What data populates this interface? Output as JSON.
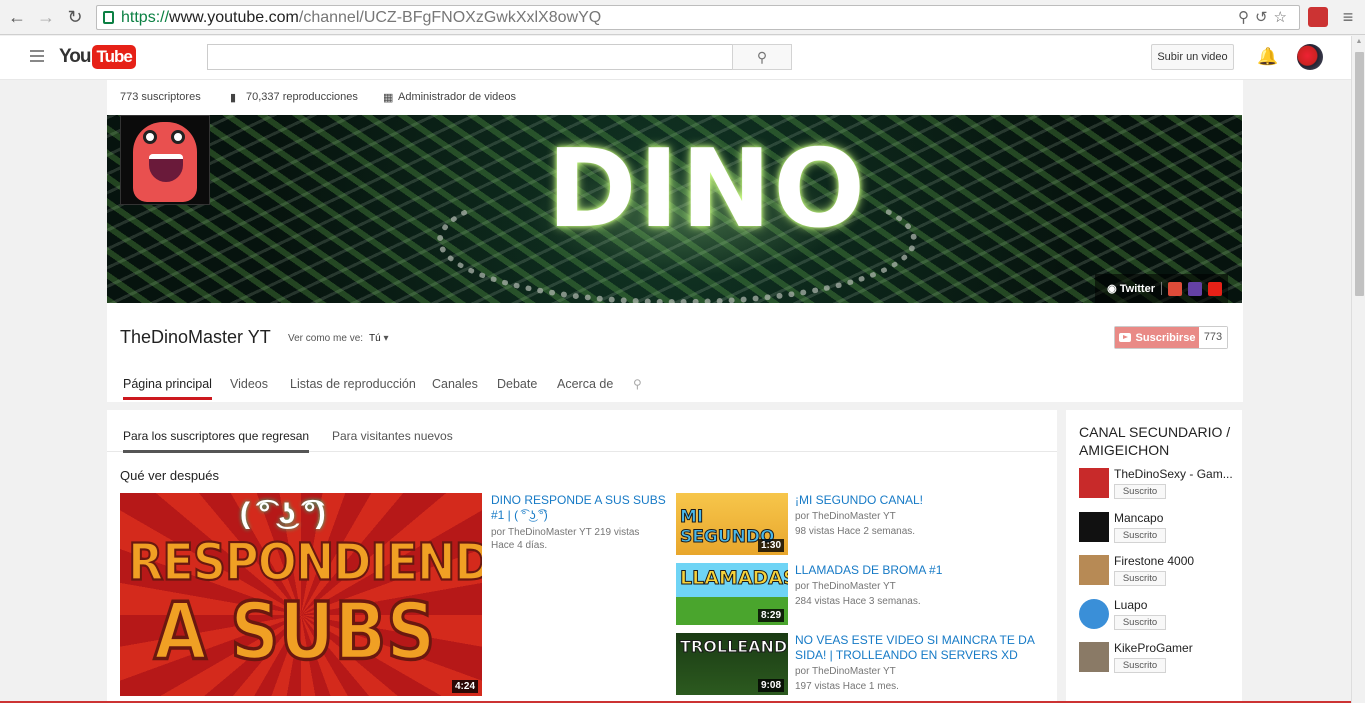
{
  "browser": {
    "url_protocol": "https://",
    "url_host": "www.youtube.com",
    "url_path": "/channel/UCZ-BFgFNOXzGwkXxlX8owYQ",
    "back_icon": "arrow-left-icon",
    "forward_icon": "arrow-right-icon",
    "reload_icon": "reload-icon"
  },
  "masthead": {
    "logo_you": "You",
    "logo_tube": "Tube",
    "search_placeholder": "",
    "upload_label": "Subir un video"
  },
  "channel": {
    "subscribers_stat": "773 suscriptores",
    "views_stat": "70,337 reproducciones",
    "video_manager": "Administrador de videos",
    "banner_text": "DINO",
    "title": "TheDinoMaster YT",
    "view_as_label": "Ver como me ve:",
    "view_as_value": "Tú",
    "twitter_label": "Twitter",
    "subscribe_label": "Suscribirse",
    "subscribe_count": "773",
    "tabs": [
      "Página principal",
      "Videos",
      "Listas de reproducción",
      "Canales",
      "Debate",
      "Acerca de"
    ]
  },
  "main": {
    "subtabs": [
      "Para los suscriptores que regresan",
      "Para visitantes nuevos"
    ],
    "section_title": "Qué ver después",
    "featured": {
      "title": "DINO RESPONDE A SUS SUBS #1 | ( ͡° ͜ʖ ͡°)",
      "meta_line1": "por TheDinoMaster YT   219 vistas",
      "meta_line2": "Hace 4 días.",
      "duration": "4:24",
      "thumb_text1": "RESPONDIENDO",
      "thumb_text2": "A SUBS",
      "thumb_face": "( ͡° ͜ʖ ͡°)"
    },
    "videos": [
      {
        "title": "¡MI SEGUNDO CANAL!",
        "by": "por TheDinoMaster YT",
        "stats": "98 vistas   Hace 2 semanas.",
        "duration": "1:30",
        "thumb_text": "MI SEGUNDO"
      },
      {
        "title": "LLAMADAS DE BROMA #1",
        "by": "por TheDinoMaster YT",
        "stats": "284 vistas   Hace 3 semanas.",
        "duration": "8:29",
        "thumb_text": "LLAMADAS"
      },
      {
        "title": "NO VEAS ESTE VIDEO SI MAINCRA TE DA SIDA! | TROLLEANDO EN SERVERS XD",
        "by": "por TheDinoMaster YT",
        "stats": "197 vistas   Hace 1 mes.",
        "duration": "9:08",
        "thumb_text": "TROLLEANDO"
      }
    ]
  },
  "sidebar": {
    "title": "CANAL SECUNDARIO / AMIGEICHON",
    "channels": [
      {
        "name": "TheDinoSexy - Gam...",
        "button": "Suscrito",
        "color": "#c82a2a"
      },
      {
        "name": "Mancapo",
        "button": "Suscrito",
        "color": "#111111"
      },
      {
        "name": "Firestone 4000",
        "button": "Suscrito",
        "color": "#b78a55"
      },
      {
        "name": "Luapo",
        "button": "Suscrito",
        "color": "#3a8fd8"
      },
      {
        "name": "KikeProGamer",
        "button": "Suscrito",
        "color": "#8a7a66"
      }
    ]
  },
  "colors": {
    "accent": "#cc181e",
    "link": "#167ac6",
    "subscribe": "#e98a86"
  }
}
